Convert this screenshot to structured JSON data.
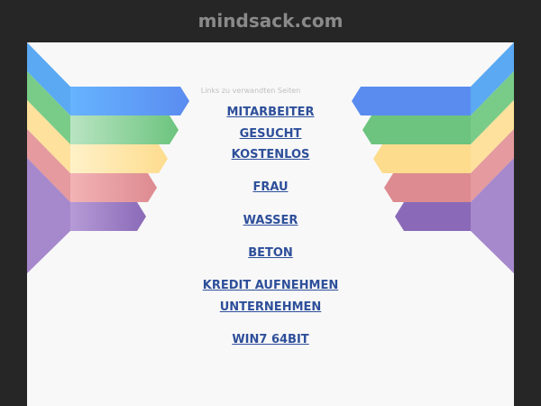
{
  "site": {
    "domain": "mindsack.com"
  },
  "related": {
    "header": "Links zu verwandten Seiten",
    "links": [
      "MITARBEITER",
      "GESUCHT",
      "KOSTENLOS",
      "FRAU",
      "WASSER",
      "BETON",
      "KREDIT AUFNEHMEN",
      "UNTERNEHMEN",
      "WIN7 64BIT"
    ]
  },
  "colors": {
    "page_bg": "#262626",
    "panel_bg": "#f8f8f8",
    "link": "#2e4f9a",
    "ribbon_blue": "#6aa8f5",
    "ribbon_green": "#7fcf8f",
    "ribbon_yellow": "#fde5a6",
    "ribbon_red": "#e79a9e",
    "ribbon_purple": "#a184c8"
  }
}
